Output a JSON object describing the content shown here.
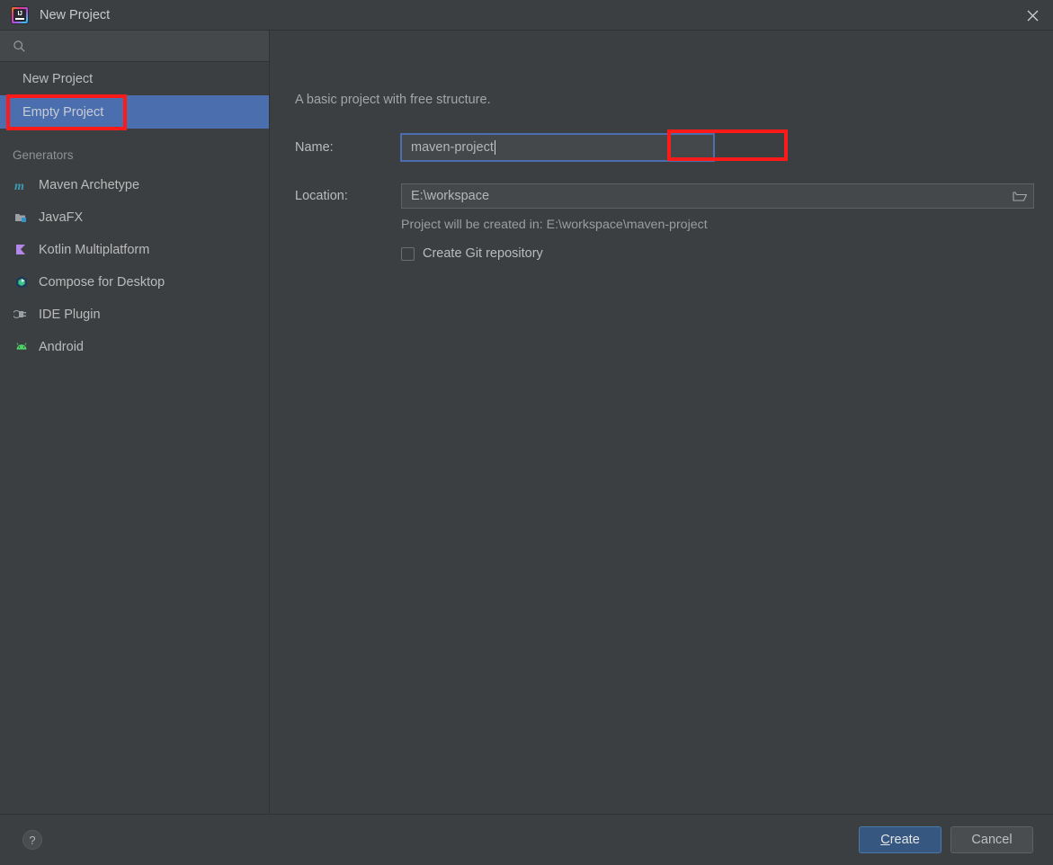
{
  "window": {
    "title": "New Project",
    "logo_icon": "intellij-idea-logo",
    "logo_text": "IJ",
    "close_icon": "close-icon"
  },
  "sidebar": {
    "search": {
      "icon": "search-icon",
      "value": "",
      "placeholder": ""
    },
    "nav_items": [
      {
        "label": "New Project",
        "selected": false
      },
      {
        "label": "Empty Project",
        "selected": true
      }
    ],
    "generators_section_label": "Generators",
    "generators": [
      {
        "label": "Maven Archetype",
        "icon": "maven-icon"
      },
      {
        "label": "JavaFX",
        "icon": "javafx-icon"
      },
      {
        "label": "Kotlin Multiplatform",
        "icon": "kotlin-icon"
      },
      {
        "label": "Compose for Desktop",
        "icon": "compose-icon"
      },
      {
        "label": "IDE Plugin",
        "icon": "ide-plugin-icon"
      },
      {
        "label": "Android",
        "icon": "android-icon"
      }
    ]
  },
  "main": {
    "description": "A basic project with free structure.",
    "name": {
      "label": "Name:",
      "value": "maven-project"
    },
    "location": {
      "label": "Location:",
      "value": "E:\\workspace",
      "browse_icon": "folder-open-icon"
    },
    "created_in_text": "Project will be created in: E:\\workspace\\maven-project",
    "git": {
      "label": "Create Git repository",
      "checked": false
    }
  },
  "footer": {
    "help_label": "?",
    "help_icon": "help-icon",
    "create_mnemonic": "C",
    "create_rest": "reate",
    "cancel_label": "Cancel"
  },
  "colors": {
    "panel_bg": "#3c3f41",
    "selection_blue": "#4b6eaf",
    "focus_blue": "#4b6eaf",
    "primary_button": "#365880",
    "annotation_red": "#ff1a1a",
    "input_bg": "#45484a"
  }
}
